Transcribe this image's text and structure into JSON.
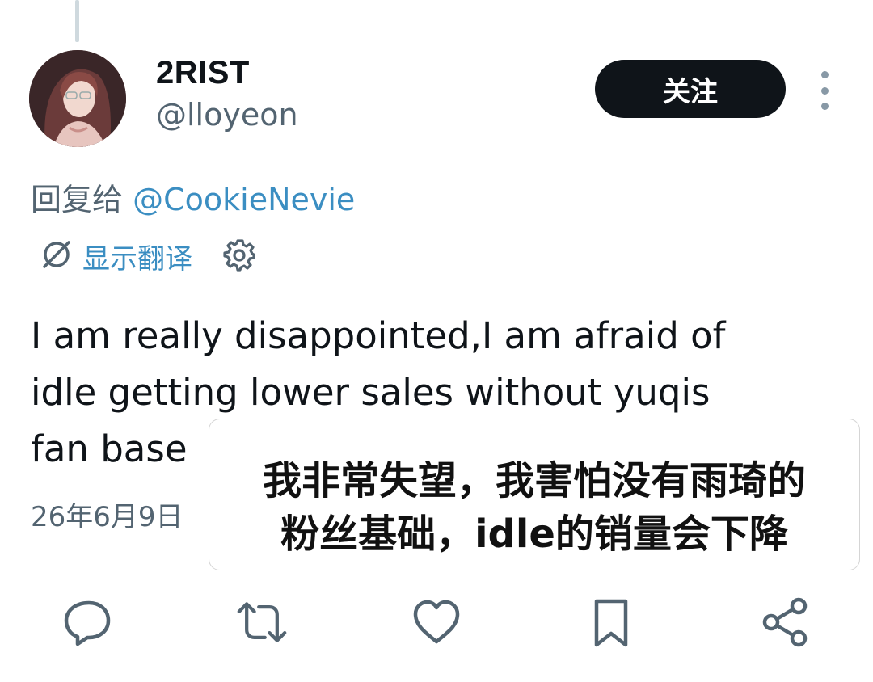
{
  "user": {
    "display_name": "2RIST",
    "handle": "@lloyeon",
    "avatar": "avatar-photo"
  },
  "follow_button": {
    "label": "关注"
  },
  "reply": {
    "prefix": "回复给 ",
    "mention": "@CookieNevie"
  },
  "translate": {
    "label": "显示翻译",
    "icon": "translate-icon",
    "settings_icon": "gear-icon"
  },
  "tweet": {
    "text": "I am really disappointed,I am afraid of\nidle getting lower sales without yuqis\nfan base",
    "timestamp": "26年6月9日"
  },
  "overlay": {
    "line1": "我非常失望，我害怕没有雨琦的",
    "line2": "粉丝基础，idle的销量会下降"
  },
  "actions": [
    {
      "name": "reply",
      "icon": "reply-icon"
    },
    {
      "name": "retweet",
      "icon": "retweet-icon"
    },
    {
      "name": "like",
      "icon": "heart-icon"
    },
    {
      "name": "bookmark",
      "icon": "bookmark-icon"
    },
    {
      "name": "share",
      "icon": "share-icon"
    }
  ],
  "colors": {
    "text_primary": "#0f1419",
    "text_secondary": "#536471",
    "link": "#3b8ec2",
    "button_bg": "#0f1419",
    "icon": "#536471"
  }
}
